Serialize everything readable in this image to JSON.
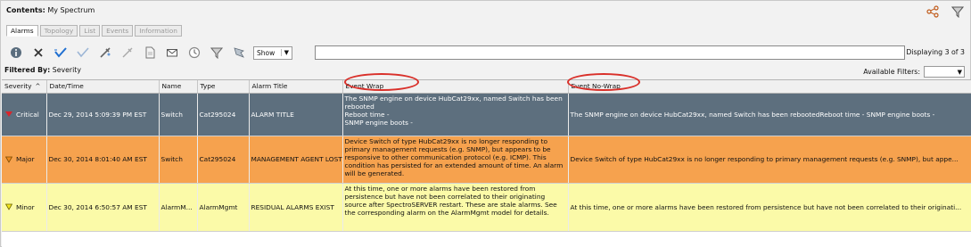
{
  "header": {
    "contents_label": "Contents:",
    "contents_value": "My Spectrum"
  },
  "tabs": [
    {
      "label": "Alarms",
      "active": true
    },
    {
      "label": "Topology",
      "active": false
    },
    {
      "label": "List",
      "active": false
    },
    {
      "label": "Events",
      "active": false
    },
    {
      "label": "Information",
      "active": false
    }
  ],
  "toolbar": {
    "icons": [
      "info-icon",
      "clear-icon",
      "acknowledge-icon",
      "unacknowledge-icon",
      "assign-icon",
      "unassign-icon",
      "report-icon",
      "email-icon",
      "clock-icon",
      "filter-icon",
      "flag-icon"
    ],
    "show_label": "Show",
    "search_value": "",
    "displaying": "Displaying 3 of 3"
  },
  "filter": {
    "label": "Filtered By:",
    "value": "Severity",
    "available_label": "Available Filters:",
    "available_value": ""
  },
  "columns": [
    "Severity",
    "Date/Time",
    "Name",
    "Type",
    "Alarm Title",
    "Event Wrap",
    "Event No-Wrap"
  ],
  "sort_indicator": "^",
  "rows": [
    {
      "severity": "Critical",
      "severity_color": "#d9252b",
      "datetime": "Dec 29, 2014 5:09:39 PM EST",
      "name": "Switch",
      "type": "Cat295024",
      "alarm_title": "ALARM TITLE",
      "event_wrap": "The SNMP engine on device HubCat29xx, named Switch has been rebooted\nReboot time -\nSNMP engine boots -",
      "event_nowrap": "The SNMP engine on device HubCat29xx, named Switch has been rebootedReboot time - SNMP engine boots -"
    },
    {
      "severity": "Major",
      "severity_color": "#f08a1c",
      "datetime": "Dec 30, 2014 8:01:40 AM EST",
      "name": "Switch",
      "type": "Cat295024",
      "alarm_title": "MANAGEMENT AGENT LOST",
      "event_wrap": "Device Switch of type HubCat29xx is no longer responding to primary management requests (e.g. SNMP), but appears to be responsive to other communication protocol (e.g. ICMP). This condition has persisted for an extended amount of time. An alarm will be generated.",
      "event_nowrap": "Device Switch of type HubCat29xx is no longer responding to primary management requests (e.g. SNMP), but appe..."
    },
    {
      "severity": "Minor",
      "severity_color": "#f3e61c",
      "datetime": "Dec 30, 2014 6:50:57 AM EST",
      "name": "AlarmM...",
      "type": "AlarmMgmt",
      "alarm_title": "RESIDUAL ALARMS EXIST",
      "event_wrap": "At this time, one or more alarms have been restored from persistence but have not been correlated to their originating source after SpectroSERVER restart. These are stale alarms. See the corresponding alarm on the AlarmMgmt model for details.",
      "event_nowrap": "At this time, one or more alarms have been restored from persistence but have not been correlated to their originati..."
    }
  ]
}
